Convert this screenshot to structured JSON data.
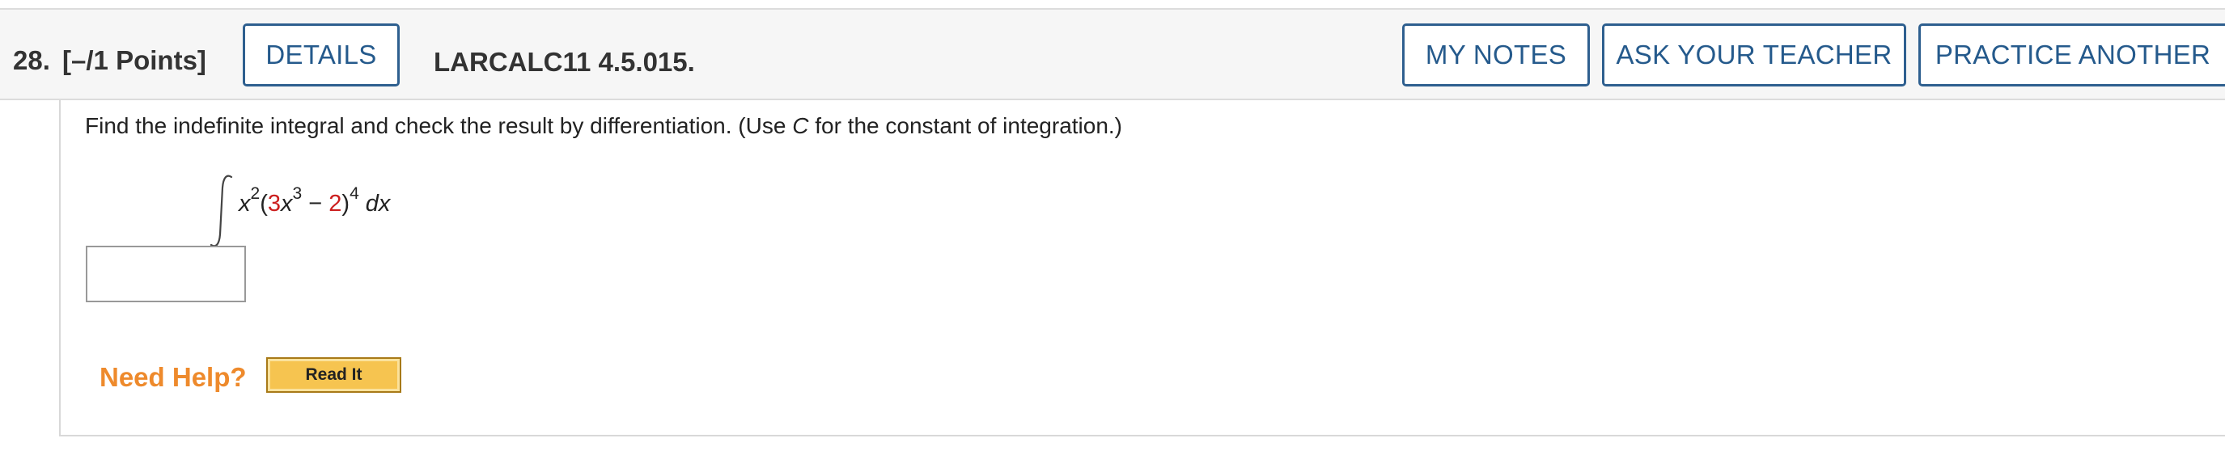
{
  "header": {
    "question_number": "28.",
    "points": "[–/1 Points]",
    "details_label": "DETAILS",
    "problem_id": "LARCALC11 4.5.015.",
    "my_notes_label": "MY NOTES",
    "ask_teacher_label": "ASK YOUR TEACHER",
    "practice_another_label": "PRACTICE ANOTHER"
  },
  "question": {
    "prompt_before": "Find the indefinite integral and check the result by differentiation. (Use ",
    "prompt_var": "C",
    "prompt_after": " for the constant of integration.)",
    "integral": {
      "symbol": "∫",
      "base": "x",
      "base_exp": "2",
      "open_paren": "(",
      "coef": "3",
      "inner_var": "x",
      "inner_exp": "3",
      "minus": " − ",
      "constant": "2",
      "close_paren": ")",
      "outer_exp": "4",
      "differential": " dx"
    },
    "answer_value": ""
  },
  "help": {
    "label": "Need Help?",
    "read_it_label": "Read It"
  },
  "colors": {
    "button_border": "#2e5f8f",
    "button_text": "#255a8c",
    "highlight_red": "#cc1f1f",
    "help_orange": "#ee8a2c",
    "read_it_bg": "#f6c450"
  }
}
